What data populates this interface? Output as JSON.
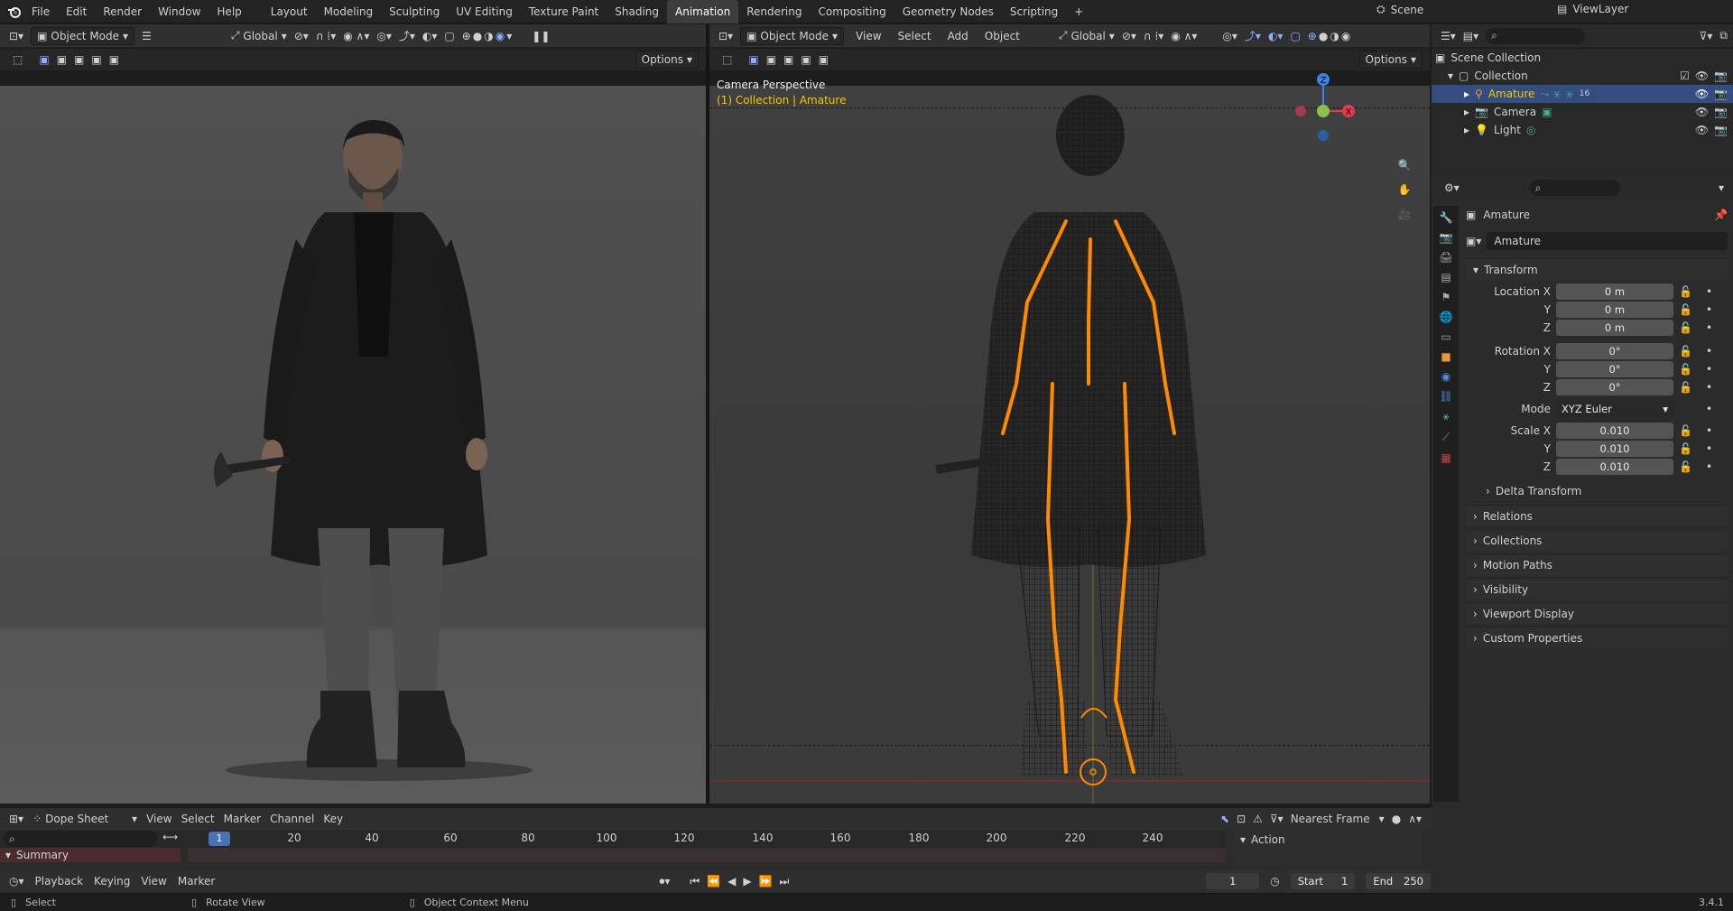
{
  "app": {
    "version": "3.4.1"
  },
  "menu": {
    "items": [
      "File",
      "Edit",
      "Render",
      "Window",
      "Help"
    ]
  },
  "workspaces": {
    "tabs": [
      "Layout",
      "Modeling",
      "Sculpting",
      "UV Editing",
      "Texture Paint",
      "Shading",
      "Animation",
      "Rendering",
      "Compositing",
      "Geometry Nodes",
      "Scripting"
    ],
    "active": "Animation",
    "add": "+"
  },
  "scene": {
    "name": "Scene",
    "view_layer": "ViewLayer"
  },
  "left_viewport": {
    "mode": "Object Mode",
    "orientation": "Global",
    "options": "Options"
  },
  "right_viewport": {
    "mode": "Object Mode",
    "menus": [
      "View",
      "Select",
      "Add",
      "Object"
    ],
    "orientation": "Global",
    "options": "Options",
    "camera_label": "Camera Perspective",
    "collection_label": "(1) Collection | Amature"
  },
  "outliner": {
    "root": "Scene Collection",
    "collection": "Collection",
    "items": [
      {
        "name": "Amature",
        "badge": "16",
        "selected": true
      },
      {
        "name": "Camera",
        "selected": false
      },
      {
        "name": "Light",
        "selected": false
      }
    ]
  },
  "properties": {
    "object_name": "Amature",
    "data_name": "Amature",
    "transform_title": "Transform",
    "location_label": "Location X",
    "y_label": "Y",
    "z_label": "Z",
    "location": [
      "0 m",
      "0 m",
      "0 m"
    ],
    "rotation_label": "Rotation X",
    "rotation": [
      "0°",
      "0°",
      "0°"
    ],
    "mode_label": "Mode",
    "mode_value": "XYZ Euler",
    "scale_label": "Scale X",
    "scale": [
      "0.010",
      "0.010",
      "0.010"
    ],
    "delta": "Delta Transform",
    "sections": [
      "Relations",
      "Collections",
      "Motion Paths",
      "Visibility",
      "Viewport Display",
      "Custom Properties"
    ]
  },
  "dopesheet": {
    "editor": "Dope Sheet",
    "menus": [
      "View",
      "Select",
      "Marker",
      "Channel",
      "Key"
    ],
    "snap": "Nearest Frame",
    "summary": "Summary",
    "action": "Action",
    "current_frame_marker": "1",
    "ticks": [
      "20",
      "40",
      "60",
      "80",
      "100",
      "120",
      "140",
      "160",
      "180",
      "200",
      "220",
      "240"
    ]
  },
  "playback": {
    "menus": [
      "Playback",
      "Keying",
      "View",
      "Marker"
    ],
    "current_frame": "1",
    "start_label": "Start",
    "start": "1",
    "end_label": "End",
    "end": "250"
  },
  "statusbar": {
    "select": "Select",
    "rotate": "Rotate View",
    "context": "Object Context Menu"
  },
  "colors": {
    "accent": "#4772b3",
    "highlight": "#f5c900",
    "bone": "#ff8a00"
  }
}
